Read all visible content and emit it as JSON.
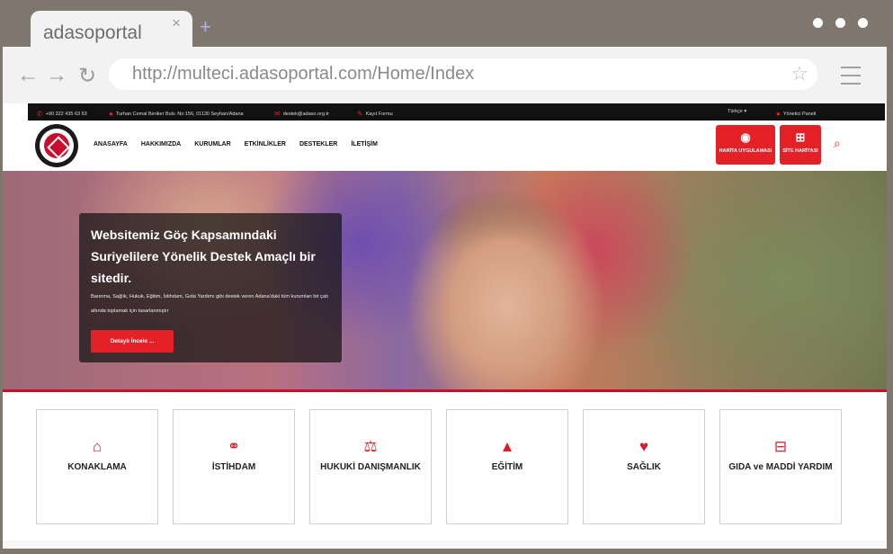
{
  "browser": {
    "tab_title": "adasoportal",
    "tab_close": "×",
    "new_tab": "+",
    "url": "http://multeci.adasoportal.com/Home/Index",
    "back": "←",
    "forward": "→",
    "reload": "↻",
    "star": "☆"
  },
  "topbar": {
    "phone": "+90 322 435 63 63",
    "address": "Turhan Cemal Beriker Bulv. No:156, 01130 Seyhan/Adana",
    "email": "destek@adaso.org.tr",
    "register": "Kayıt Formu",
    "language": "Türkçe ▾",
    "admin": "Yönetici Paneli"
  },
  "nav": {
    "items": [
      "ANASAYFA",
      "HAKKIMIZDA",
      "KURUMLAR",
      "ETKİNLİKLER",
      "DESTEKLER",
      "İLETİŞİM"
    ],
    "map_app": "HARİTA UYGULAMASI",
    "site_map": "SİTE HARİTASI"
  },
  "hero": {
    "title": "Websitemiz Göç Kapsamındaki Suriyelilere Yönelik Destek Amaçlı bir sitedir.",
    "description": "Barınma, Sağlık, Hukuk, Eğitim, İstihdam, Gıda Yardımı gibi destek veren Adana'daki tüm kurumları bir çatı altında toplamak için tasarlanmıştır",
    "button": "Detaylı İncele ..."
  },
  "cards": [
    {
      "label": "KONAKLAMA",
      "icon": "home-icon"
    },
    {
      "label": "İSTİHDAM",
      "icon": "handshake-icon"
    },
    {
      "label": "HUKUKİ DANIŞMANLIK",
      "icon": "scales-icon"
    },
    {
      "label": "EĞİTİM",
      "icon": "graduation-cap-icon"
    },
    {
      "label": "SAĞLIK",
      "icon": "heartbeat-icon"
    },
    {
      "label": "GIDA ve MADDİ YARDIM",
      "icon": "basket-icon"
    }
  ],
  "colors": {
    "accent": "#e32127",
    "topbar": "#111111",
    "chrome": "#7f776d"
  }
}
